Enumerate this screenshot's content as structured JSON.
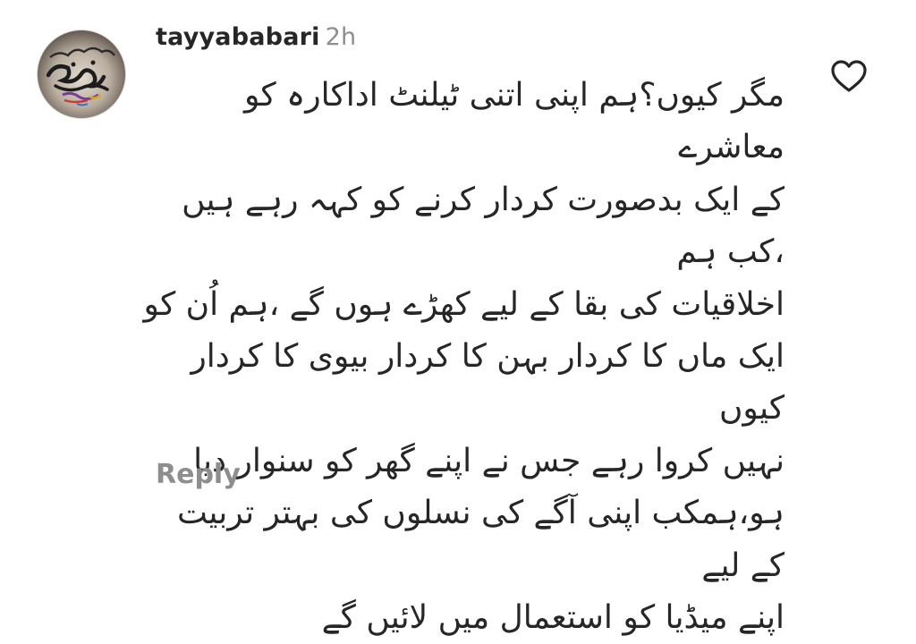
{
  "comment": {
    "username": "tayyababari",
    "time": "2h",
    "text_lines": [
      "مگر کیوں؟ہم اپنی اتنی ٹیلنٹ اداکارہ کو معاشرے",
      "کے ایک بدصورت کردار کرنے کو کہہ رہے ہیں ،کب ہم",
      "اخلاقیات کی بقا کے لیے کھڑے ہوں گے ،ہم اُن کو",
      "ایک ماں کا کردار بہن کا کردار بیوی کا کردار کیوں",
      "نہیں کروا رہے جس نے اپنے گھر کو سنوار دیا",
      "ہو،ہمکب اپنی آگے کی نسلوں کی بہتر تربیت کے لیے",
      "اپنے میڈیا کو استعمال میں لائیں گے"
    ],
    "reply_label": "Reply"
  },
  "icons": {
    "like": "heart-outline-icon",
    "avatar": "calligraphy-avatar"
  },
  "colors": {
    "primary_text": "#262626",
    "secondary_text": "#8e8e8e",
    "background": "#ffffff"
  }
}
